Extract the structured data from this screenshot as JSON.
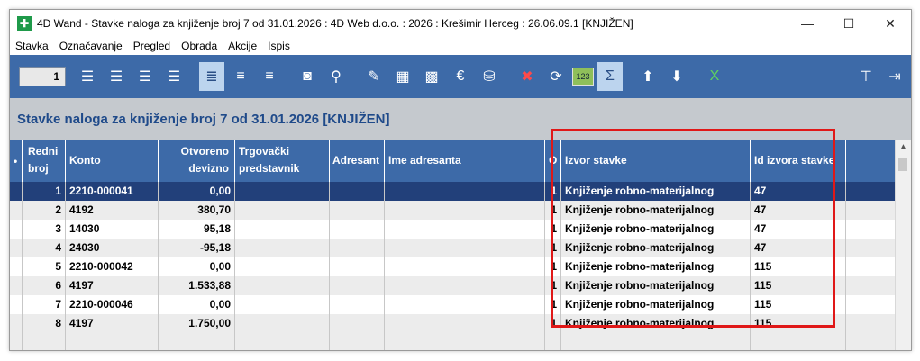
{
  "window": {
    "title": "4D Wand - Stavke naloga za knjiženje broj 7 od 31.01.2026 : 4D Web d.o.o. : 2026 : Krešimir Herceg : 26.06.09.1 [KNJIŽEN]",
    "app_icon": "4d-wand-app-icon",
    "controls": {
      "minimize": "—",
      "maximize": "☐",
      "close": "✕"
    }
  },
  "menu": [
    "Stavka",
    "Označavanje",
    "Pregled",
    "Obrada",
    "Akcije",
    "Ispis"
  ],
  "toolbar": {
    "record_number": "1",
    "icons": [
      "add-row-icon",
      "add-row-alt-icon",
      "delete-row-icon",
      "refresh-row-icon",
      "list-view-icon",
      "list-view-alt-icon",
      "list-view-compact-icon",
      "binoculars-icon",
      "search-icon",
      "edit-document-icon",
      "calendar-edit-icon",
      "grid-edit-icon",
      "currency-icon",
      "database-edit-icon",
      "cancel-icon",
      "sync-icon",
      "numbering-icon",
      "sum-icon",
      "arrow-up-icon",
      "arrow-down-icon",
      "excel-icon",
      "filter-icon",
      "exit-icon"
    ],
    "badge_text": "123"
  },
  "page": {
    "title": "Stavke naloga za knjiženje broj 7 od 31.01.2026 [KNJIŽEN]"
  },
  "table": {
    "columns": {
      "redni_a": "Redni",
      "redni_b": "broj",
      "konto": "Konto",
      "otv_a": "Otvoreno",
      "otv_b": "devizno",
      "trg_a": "Trgovački",
      "trg_b": "predstavnik",
      "adresant": "Adresant",
      "ime": "Ime adresanta",
      "o": "O",
      "izvor": "Izvor stavke",
      "id_izvora": "Id izvora stavke"
    },
    "rows": [
      {
        "rb": "1",
        "konto": "2210-000041",
        "otv": "0,00",
        "o": "1",
        "izvor": "Knjiženje robno-materijalnog",
        "id": "47"
      },
      {
        "rb": "2",
        "konto": "4192",
        "otv": "380,70",
        "o": "1",
        "izvor": "Knjiženje robno-materijalnog",
        "id": "47"
      },
      {
        "rb": "3",
        "konto": "14030",
        "otv": "95,18",
        "o": "1",
        "izvor": "Knjiženje robno-materijalnog",
        "id": "47"
      },
      {
        "rb": "4",
        "konto": "24030",
        "otv": "-95,18",
        "o": "1",
        "izvor": "Knjiženje robno-materijalnog",
        "id": "47"
      },
      {
        "rb": "5",
        "konto": "2210-000042",
        "otv": "0,00",
        "o": "1",
        "izvor": "Knjiženje robno-materijalnog",
        "id": "115"
      },
      {
        "rb": "6",
        "konto": "4197",
        "otv": "1.533,88",
        "o": "1",
        "izvor": "Knjiženje robno-materijalnog",
        "id": "115"
      },
      {
        "rb": "7",
        "konto": "2210-000046",
        "otv": "0,00",
        "o": "1",
        "izvor": "Knjiženje robno-materijalnog",
        "id": "115"
      },
      {
        "rb": "8",
        "konto": "4197",
        "otv": "1.750,00",
        "o": "1",
        "izvor": "Knjiženje robno-materijalnog",
        "id": "115"
      }
    ]
  },
  "colors": {
    "toolbar_bg": "#3d6aa8",
    "header_bg": "#c5c9ce",
    "selected_row": "#22407a",
    "highlight": "#e01818",
    "title_text": "#1f4a8a"
  }
}
